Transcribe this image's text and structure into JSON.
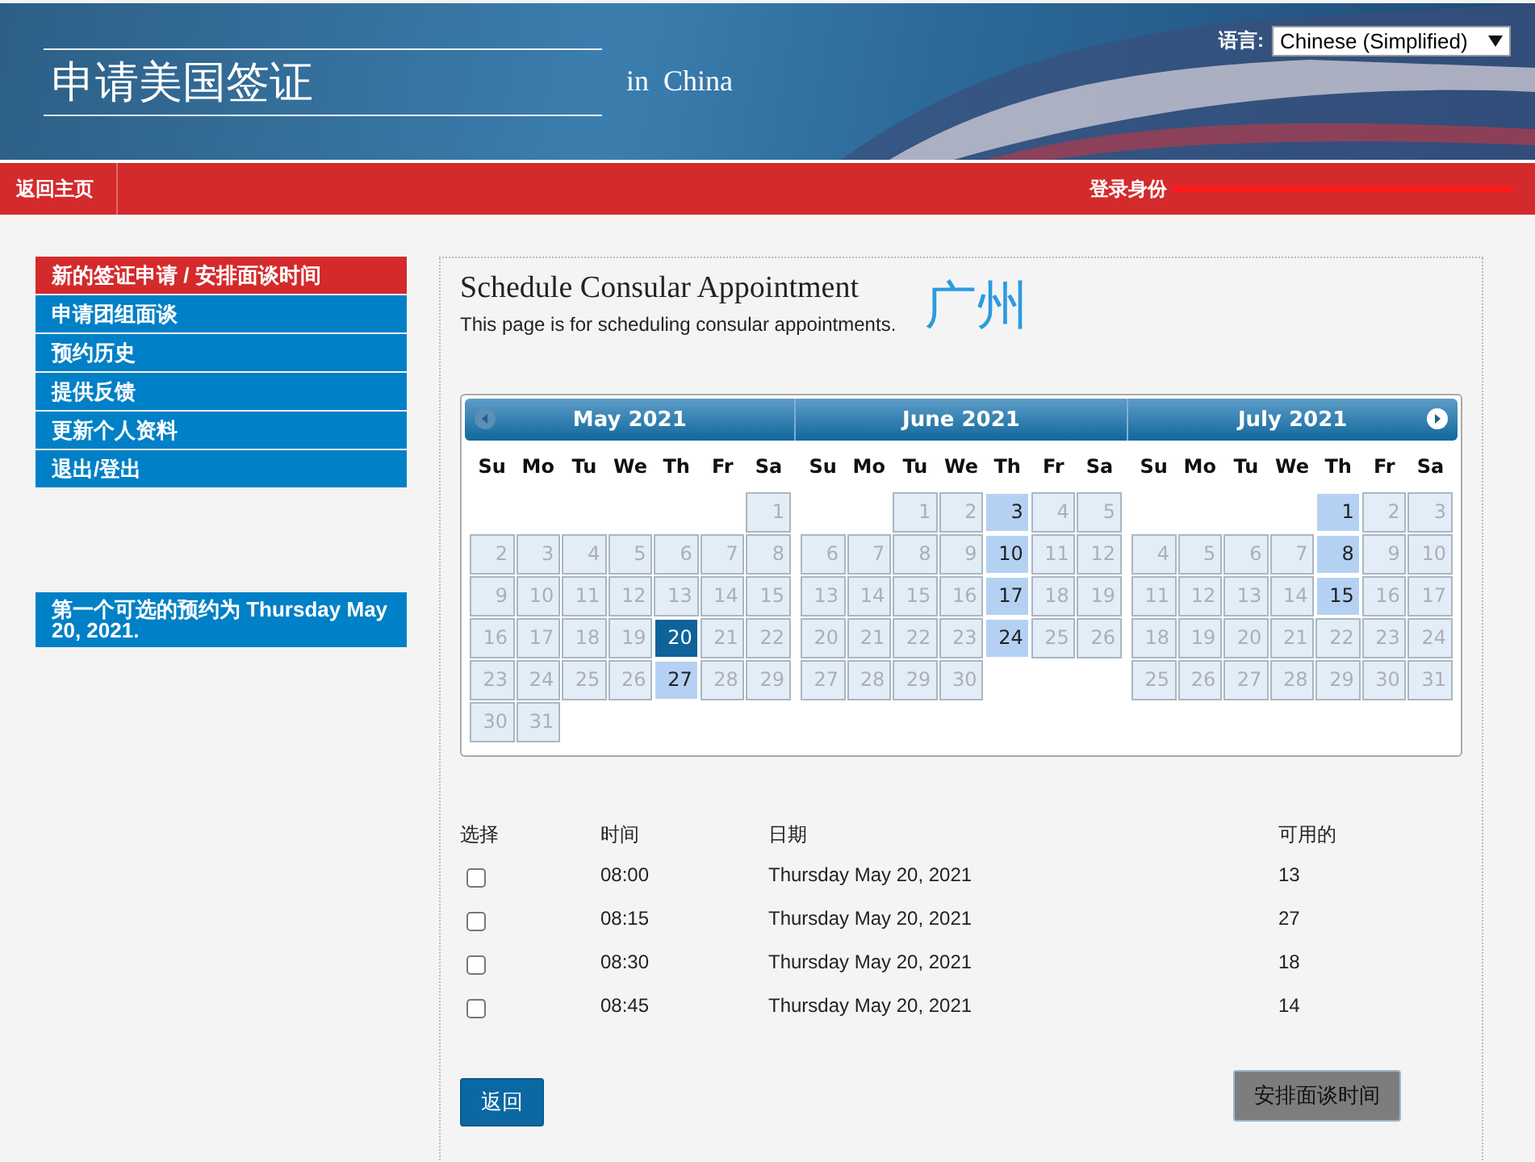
{
  "header": {
    "title": "申请美国签证",
    "subtitle": "in  China",
    "language_label": "语言:",
    "language_value": "Chinese (Simplified)"
  },
  "nav_bar": {
    "home": "返回主页",
    "login_label": "登录身份"
  },
  "sidebar": {
    "items": [
      {
        "label": "新的签证申请 / 安排面谈时间",
        "selected": true
      },
      {
        "label": "申请团组面谈",
        "selected": false
      },
      {
        "label": "预约历史",
        "selected": false
      },
      {
        "label": "提供反馈",
        "selected": false
      },
      {
        "label": "更新个人资料",
        "selected": false
      },
      {
        "label": "退出/登出",
        "selected": false
      }
    ],
    "notice": "第一个可选的预约为 Thursday May 20, 2021."
  },
  "main": {
    "title": "Schedule Consular Appointment",
    "subtitle": "This page is for scheduling consular appointments.",
    "city": "广州"
  },
  "calendar": {
    "months": [
      {
        "title": "May 2021",
        "weekdays": [
          "Su",
          "Mo",
          "Tu",
          "We",
          "Th",
          "Fr",
          "Sa"
        ],
        "weeks": [
          [
            {
              "label": "1",
              "available": false,
              "selected": false
            }
          ],
          [
            {
              "label": "2",
              "available": false,
              "selected": false
            },
            {
              "label": "3",
              "available": false,
              "selected": false
            },
            {
              "label": "4",
              "available": false,
              "selected": false
            },
            {
              "label": "5",
              "available": false,
              "selected": false
            },
            {
              "label": "6",
              "available": false,
              "selected": false
            },
            {
              "label": "7",
              "available": false,
              "selected": false
            },
            {
              "label": "8",
              "available": false,
              "selected": false
            }
          ],
          [
            {
              "label": "9",
              "available": false,
              "selected": false
            },
            {
              "label": "10",
              "available": false,
              "selected": false
            },
            {
              "label": "11",
              "available": false,
              "selected": false
            },
            {
              "label": "12",
              "available": false,
              "selected": false
            },
            {
              "label": "13",
              "available": false,
              "selected": false
            },
            {
              "label": "14",
              "available": false,
              "selected": false
            },
            {
              "label": "15",
              "available": false,
              "selected": false
            }
          ],
          [
            {
              "label": "16",
              "available": false,
              "selected": false
            },
            {
              "label": "17",
              "available": false,
              "selected": false
            },
            {
              "label": "18",
              "available": false,
              "selected": false
            },
            {
              "label": "19",
              "available": false,
              "selected": false
            },
            {
              "label": "20",
              "available": true,
              "selected": true
            },
            {
              "label": "21",
              "available": false,
              "selected": false
            },
            {
              "label": "22",
              "available": false,
              "selected": false
            }
          ],
          [
            {
              "label": "23",
              "available": false,
              "selected": false
            },
            {
              "label": "24",
              "available": false,
              "selected": false
            },
            {
              "label": "25",
              "available": false,
              "selected": false
            },
            {
              "label": "26",
              "available": false,
              "selected": false
            },
            {
              "label": "27",
              "available": true,
              "selected": false
            },
            {
              "label": "28",
              "available": false,
              "selected": false
            },
            {
              "label": "29",
              "available": false,
              "selected": false
            }
          ],
          [
            {
              "label": "30",
              "available": false,
              "selected": false
            },
            {
              "label": "31",
              "available": false,
              "selected": false
            }
          ]
        ]
      },
      {
        "title": "June 2021",
        "weekdays": [
          "Su",
          "Mo",
          "Tu",
          "We",
          "Th",
          "Fr",
          "Sa"
        ],
        "weeks": [
          [
            {
              "label": "1",
              "available": false,
              "selected": false
            },
            {
              "label": "2",
              "available": false,
              "selected": false
            },
            {
              "label": "3",
              "available": true,
              "selected": false
            },
            {
              "label": "4",
              "available": false,
              "selected": false
            },
            {
              "label": "5",
              "available": false,
              "selected": false
            }
          ],
          [
            {
              "label": "6",
              "available": false,
              "selected": false
            },
            {
              "label": "7",
              "available": false,
              "selected": false
            },
            {
              "label": "8",
              "available": false,
              "selected": false
            },
            {
              "label": "9",
              "available": false,
              "selected": false
            },
            {
              "label": "10",
              "available": true,
              "selected": false
            },
            {
              "label": "11",
              "available": false,
              "selected": false
            },
            {
              "label": "12",
              "available": false,
              "selected": false
            }
          ],
          [
            {
              "label": "13",
              "available": false,
              "selected": false
            },
            {
              "label": "14",
              "available": false,
              "selected": false
            },
            {
              "label": "15",
              "available": false,
              "selected": false
            },
            {
              "label": "16",
              "available": false,
              "selected": false
            },
            {
              "label": "17",
              "available": true,
              "selected": false
            },
            {
              "label": "18",
              "available": false,
              "selected": false
            },
            {
              "label": "19",
              "available": false,
              "selected": false
            }
          ],
          [
            {
              "label": "20",
              "available": false,
              "selected": false
            },
            {
              "label": "21",
              "available": false,
              "selected": false
            },
            {
              "label": "22",
              "available": false,
              "selected": false
            },
            {
              "label": "23",
              "available": false,
              "selected": false
            },
            {
              "label": "24",
              "available": true,
              "selected": false
            },
            {
              "label": "25",
              "available": false,
              "selected": false
            },
            {
              "label": "26",
              "available": false,
              "selected": false
            }
          ],
          [
            {
              "label": "27",
              "available": false,
              "selected": false
            },
            {
              "label": "28",
              "available": false,
              "selected": false
            },
            {
              "label": "29",
              "available": false,
              "selected": false
            },
            {
              "label": "30",
              "available": false,
              "selected": false
            }
          ]
        ]
      },
      {
        "title": "July 2021",
        "weekdays": [
          "Su",
          "Mo",
          "Tu",
          "We",
          "Th",
          "Fr",
          "Sa"
        ],
        "weeks": [
          [
            {
              "label": "1",
              "available": true,
              "selected": false
            },
            {
              "label": "2",
              "available": false,
              "selected": false
            },
            {
              "label": "3",
              "available": false,
              "selected": false
            }
          ],
          [
            {
              "label": "4",
              "available": false,
              "selected": false
            },
            {
              "label": "5",
              "available": false,
              "selected": false
            },
            {
              "label": "6",
              "available": false,
              "selected": false
            },
            {
              "label": "7",
              "available": false,
              "selected": false
            },
            {
              "label": "8",
              "available": true,
              "selected": false
            },
            {
              "label": "9",
              "available": false,
              "selected": false
            },
            {
              "label": "10",
              "available": false,
              "selected": false
            }
          ],
          [
            {
              "label": "11",
              "available": false,
              "selected": false
            },
            {
              "label": "12",
              "available": false,
              "selected": false
            },
            {
              "label": "13",
              "available": false,
              "selected": false
            },
            {
              "label": "14",
              "available": false,
              "selected": false
            },
            {
              "label": "15",
              "available": true,
              "selected": false
            },
            {
              "label": "16",
              "available": false,
              "selected": false
            },
            {
              "label": "17",
              "available": false,
              "selected": false
            }
          ],
          [
            {
              "label": "18",
              "available": false,
              "selected": false
            },
            {
              "label": "19",
              "available": false,
              "selected": false
            },
            {
              "label": "20",
              "available": false,
              "selected": false
            },
            {
              "label": "21",
              "available": false,
              "selected": false
            },
            {
              "label": "22",
              "available": false,
              "selected": false
            },
            {
              "label": "23",
              "available": false,
              "selected": false
            },
            {
              "label": "24",
              "available": false,
              "selected": false
            }
          ],
          [
            {
              "label": "25",
              "available": false,
              "selected": false
            },
            {
              "label": "26",
              "available": false,
              "selected": false
            },
            {
              "label": "27",
              "available": false,
              "selected": false
            },
            {
              "label": "28",
              "available": false,
              "selected": false
            },
            {
              "label": "29",
              "available": false,
              "selected": false
            },
            {
              "label": "30",
              "available": false,
              "selected": false
            },
            {
              "label": "31",
              "available": false,
              "selected": false
            }
          ]
        ]
      }
    ]
  },
  "slots": {
    "columns": [
      "选择",
      "时间",
      "日期",
      "可用的"
    ],
    "rows": [
      {
        "checked": false,
        "time": "08:00",
        "date": "Thursday May 20, 2021",
        "available": "13"
      },
      {
        "checked": false,
        "time": "08:15",
        "date": "Thursday May 20, 2021",
        "available": "27"
      },
      {
        "checked": false,
        "time": "08:30",
        "date": "Thursday May 20, 2021",
        "available": "18"
      },
      {
        "checked": false,
        "time": "08:45",
        "date": "Thursday May 20, 2021",
        "available": "14"
      }
    ]
  },
  "buttons": {
    "back": "返回",
    "schedule": "安排面谈时间"
  }
}
